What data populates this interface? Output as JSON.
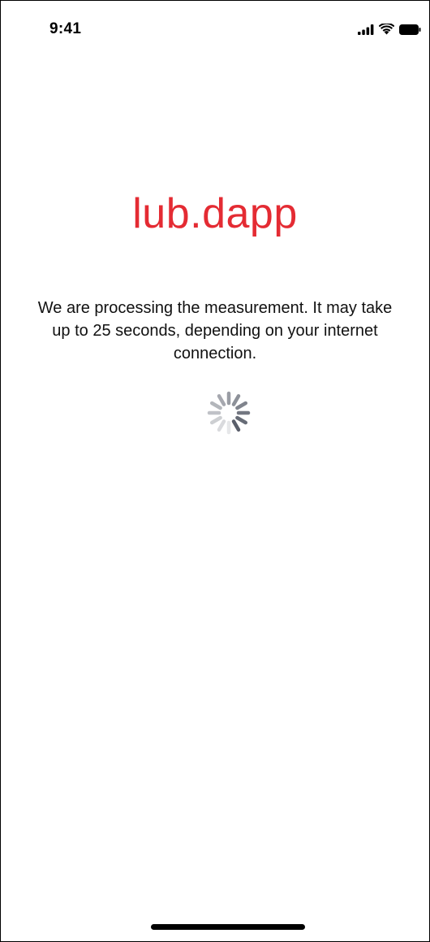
{
  "status_bar": {
    "time": "9:41",
    "icons": [
      "cellular-signal-icon",
      "wifi-icon",
      "battery-icon"
    ]
  },
  "brand": {
    "name": "lub.dapp",
    "color": "#e42b33"
  },
  "message": {
    "text": "We are processing the measurement. It may take up to 25 seconds, depending on your internet connection."
  },
  "loading": {
    "state": "in-progress",
    "icon": "loading-spinner-icon"
  }
}
